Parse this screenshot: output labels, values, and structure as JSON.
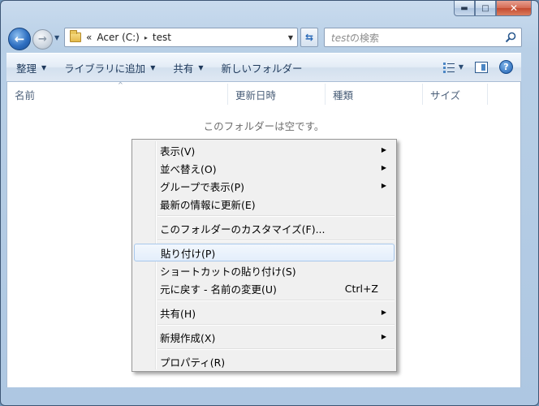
{
  "window": {
    "caption_min": "▬",
    "caption_max": "□",
    "caption_close": "✕"
  },
  "address": {
    "chevrons": "«",
    "segments": [
      "Acer (C:)",
      "test"
    ],
    "separator": "▸"
  },
  "search": {
    "placeholder_italic": "test",
    "placeholder_rest": "の検索"
  },
  "toolbar": {
    "organize": "整理",
    "add_to_library": "ライブラリに追加",
    "share": "共有",
    "new_folder": "新しいフォルダー"
  },
  "columns": [
    "名前",
    "更新日時",
    "種類",
    "サイズ"
  ],
  "empty_message": "このフォルダーは空です。",
  "context_menu": {
    "items": [
      {
        "label": "表示(V)",
        "submenu": true
      },
      {
        "label": "並べ替え(O)",
        "submenu": true
      },
      {
        "label": "グループで表示(P)",
        "submenu": true
      },
      {
        "label": "最新の情報に更新(E)",
        "submenu": false
      },
      {
        "label": "このフォルダーのカスタマイズ(F)...",
        "submenu": false
      },
      {
        "label": "貼り付け(P)",
        "submenu": false,
        "highlighted": true
      },
      {
        "label": "ショートカットの貼り付け(S)",
        "submenu": false
      },
      {
        "label": "元に戻す - 名前の変更(U)",
        "submenu": false,
        "shortcut": "Ctrl+Z"
      },
      {
        "label": "共有(H)",
        "submenu": true
      },
      {
        "label": "新規作成(X)",
        "submenu": true
      },
      {
        "label": "プロパティ(R)",
        "submenu": false
      }
    ]
  }
}
